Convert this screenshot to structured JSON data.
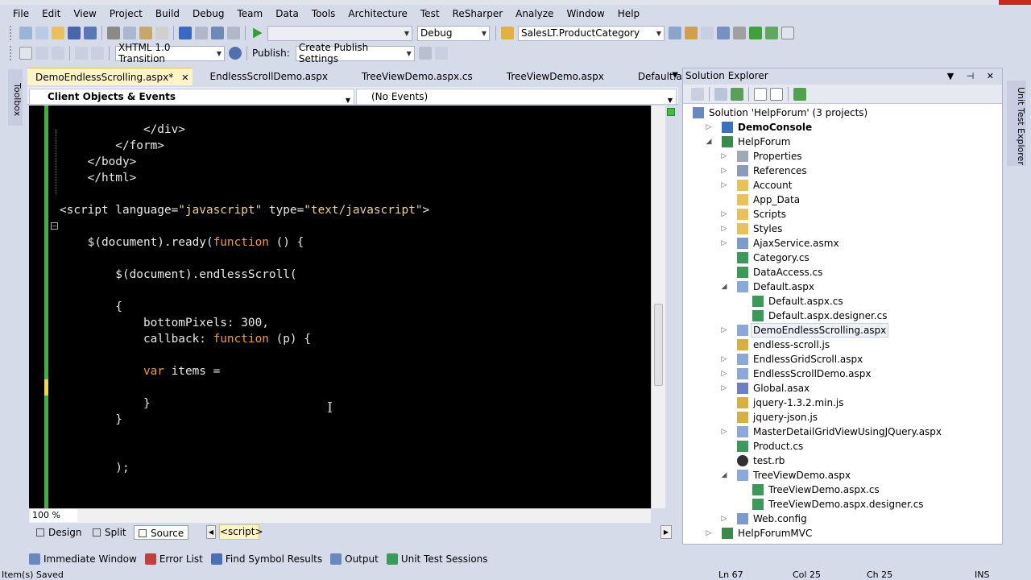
{
  "menu": [
    "File",
    "Edit",
    "View",
    "Project",
    "Build",
    "Debug",
    "Team",
    "Data",
    "Tools",
    "Architecture",
    "Test",
    "ReSharper",
    "Analyze",
    "Window",
    "Help"
  ],
  "toolbar1": {
    "solution_config": "Debug",
    "find_combo": "SalesLT.ProductCategory"
  },
  "toolbar2": {
    "doctype": "XHTML 1.0 Transition",
    "publish_label": "Publish:",
    "publish_settings": "Create Publish Settings"
  },
  "toolbox_label": "Toolbox",
  "unit_test_explorer_label": "Unit Test Explorer",
  "tabs": [
    {
      "label": "DemoEndlessScrolling.aspx*",
      "active": true
    },
    {
      "label": "EndlessScrollDemo.aspx"
    },
    {
      "label": "TreeViewDemo.aspx.cs"
    },
    {
      "label": "TreeViewDemo.aspx"
    },
    {
      "label": "Default.aspx.cs"
    }
  ],
  "nav": {
    "left": "Client Objects & Events",
    "right": "(No Events)"
  },
  "code_lines": [
    [],
    [
      [
        "t",
        "            </div>"
      ]
    ],
    [
      [
        "t",
        "        </form>"
      ]
    ],
    [
      [
        "t",
        "    </body>"
      ]
    ],
    [
      [
        "t",
        "    </html>"
      ]
    ],
    [],
    [
      [
        "t",
        "<script language="
      ],
      [
        "s",
        "\"javascript\""
      ],
      [
        "t",
        " type="
      ],
      [
        "s",
        "\"text/javascript\""
      ],
      [
        "t",
        ">"
      ]
    ],
    [],
    [
      [
        "t",
        "    $(document).ready("
      ],
      [
        "k",
        "function"
      ],
      [
        "t",
        " () {"
      ]
    ],
    [],
    [
      [
        "t",
        "        $(document).endlessScroll("
      ]
    ],
    [],
    [
      [
        "t",
        "        {"
      ]
    ],
    [
      [
        "t",
        "            bottomPixels: 300,"
      ]
    ],
    [
      [
        "t",
        "            callback: "
      ],
      [
        "k",
        "function"
      ],
      [
        "t",
        " (p) {"
      ]
    ],
    [],
    [
      [
        "t",
        "            "
      ],
      [
        "k",
        "var"
      ],
      [
        "t",
        " items ="
      ]
    ],
    [],
    [
      [
        "t",
        "            }"
      ]
    ],
    [
      [
        "t",
        "        }"
      ]
    ],
    [],
    [],
    [
      [
        "t",
        "        );"
      ]
    ]
  ],
  "editor": {
    "zoom": "100 %"
  },
  "view_buttons": {
    "design": "Design",
    "split": "Split",
    "source": "Source",
    "breadcrumb": "<script>"
  },
  "solution_explorer": {
    "title": "Solution Explorer",
    "items": [
      {
        "label": "Solution 'HelpForum' (3 projects)",
        "level": 0,
        "expand": "",
        "icon": "solution"
      },
      {
        "label": "DemoConsole",
        "level": 1,
        "expand": "▷",
        "icon": "project",
        "bold": true
      },
      {
        "label": "HelpForum",
        "level": 1,
        "expand": "◢",
        "icon": "webproject"
      },
      {
        "label": "Properties",
        "level": 2,
        "expand": "▷",
        "icon": "properties"
      },
      {
        "label": "References",
        "level": 2,
        "expand": "▷",
        "icon": "references"
      },
      {
        "label": "Account",
        "level": 2,
        "expand": "▷",
        "icon": "folder"
      },
      {
        "label": "App_Data",
        "level": 2,
        "expand": "",
        "icon": "folder"
      },
      {
        "label": "Scripts",
        "level": 2,
        "expand": "▷",
        "icon": "folder"
      },
      {
        "label": "Styles",
        "level": 2,
        "expand": "▷",
        "icon": "folder"
      },
      {
        "label": "AjaxService.asmx",
        "level": 2,
        "expand": "▷",
        "icon": "asmx"
      },
      {
        "label": "Category.cs",
        "level": 2,
        "expand": "",
        "icon": "cs"
      },
      {
        "label": "DataAccess.cs",
        "level": 2,
        "expand": "",
        "icon": "cs"
      },
      {
        "label": "Default.aspx",
        "level": 2,
        "expand": "◢",
        "icon": "aspx"
      },
      {
        "label": "Default.aspx.cs",
        "level": 3,
        "expand": "",
        "icon": "cs"
      },
      {
        "label": "Default.aspx.designer.cs",
        "level": 3,
        "expand": "",
        "icon": "cs"
      },
      {
        "label": "DemoEndlessScrolling.aspx",
        "level": 2,
        "expand": "▷",
        "icon": "aspx",
        "selected": true
      },
      {
        "label": "endless-scroll.js",
        "level": 2,
        "expand": "",
        "icon": "js"
      },
      {
        "label": "EndlessGridScroll.aspx",
        "level": 2,
        "expand": "▷",
        "icon": "aspx"
      },
      {
        "label": "EndlessScrollDemo.aspx",
        "level": 2,
        "expand": "▷",
        "icon": "aspx"
      },
      {
        "label": "Global.asax",
        "level": 2,
        "expand": "▷",
        "icon": "asax"
      },
      {
        "label": "jquery-1.3.2.min.js",
        "level": 2,
        "expand": "",
        "icon": "js"
      },
      {
        "label": "jquery-json.js",
        "level": 2,
        "expand": "",
        "icon": "js"
      },
      {
        "label": "MasterDetailGridViewUsingJQuery.aspx",
        "level": 2,
        "expand": "▷",
        "icon": "aspx"
      },
      {
        "label": "Product.cs",
        "level": 2,
        "expand": "",
        "icon": "cs"
      },
      {
        "label": "test.rb",
        "level": 2,
        "expand": "",
        "icon": "rb"
      },
      {
        "label": "TreeViewDemo.aspx",
        "level": 2,
        "expand": "◢",
        "icon": "aspx"
      },
      {
        "label": "TreeViewDemo.aspx.cs",
        "level": 3,
        "expand": "",
        "icon": "cs"
      },
      {
        "label": "TreeViewDemo.aspx.designer.cs",
        "level": 3,
        "expand": "",
        "icon": "cs"
      },
      {
        "label": "Web.config",
        "level": 2,
        "expand": "▷",
        "icon": "config"
      },
      {
        "label": "HelpForumMVC",
        "level": 1,
        "expand": "▷",
        "icon": "webproject"
      }
    ]
  },
  "bottom_tabs": [
    "Immediate Window",
    "Error List",
    "Find Symbol Results",
    "Output",
    "Unit Test Sessions"
  ],
  "status": {
    "message": "Item(s) Saved",
    "line": "Ln 67",
    "col": "Col 25",
    "ch": "Ch 25",
    "mode": "INS"
  },
  "colors": {
    "keyword": "#f29c2f",
    "string": "#f0d38a",
    "text": "#f2f2f2",
    "editor_bg": "#000000",
    "chrome": "#d6dbe9",
    "active_tab": "#fef5c6"
  }
}
